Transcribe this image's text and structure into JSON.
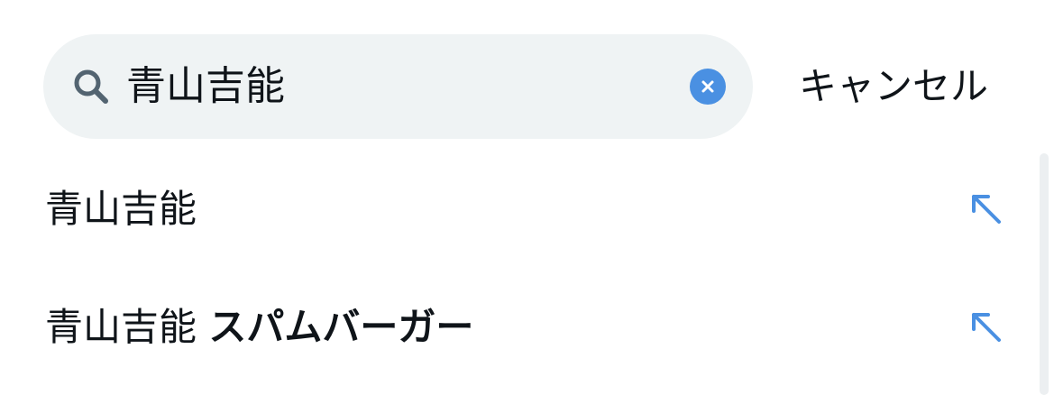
{
  "search": {
    "query": "青山吉能",
    "cancel_label": "キャンセル"
  },
  "suggestions": [
    {
      "prefix": "青山吉能",
      "suffix": ""
    },
    {
      "prefix": "青山吉能 ",
      "suffix": "スパムバーガー"
    }
  ],
  "icons": {
    "search": "search-icon",
    "clear": "clear-icon",
    "fill": "arrow-up-left-icon"
  },
  "colors": {
    "search_bg": "#eff3f4",
    "accent": "#4a90e2",
    "text": "#0f1419",
    "icon_gray": "#536471"
  }
}
